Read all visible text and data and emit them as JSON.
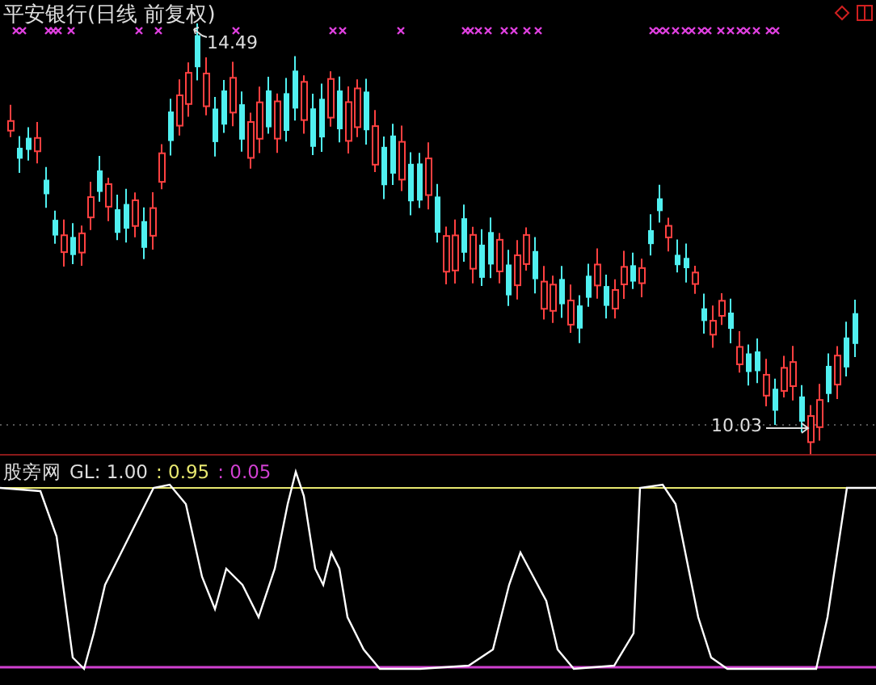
{
  "chart": {
    "title": "平安银行(日线 前复权)",
    "high_label": "14.49",
    "low_label": "10.03"
  },
  "indicator": {
    "name": "股旁网",
    "label": "GL: 1.00",
    "value_1": ": 0.95",
    "value_2": ": 0.05"
  }
}
